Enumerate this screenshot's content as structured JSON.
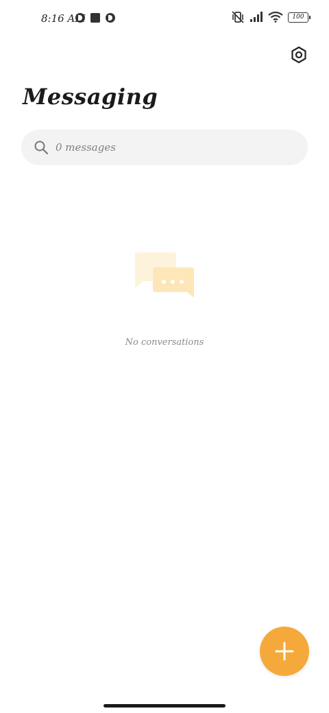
{
  "status_bar": {
    "time": "8:16 AM",
    "battery": "100"
  },
  "header": {
    "title": "Messaging"
  },
  "search": {
    "placeholder": "0 messages"
  },
  "empty_state": {
    "text": "No conversations"
  },
  "colors": {
    "accent": "#f6a93b",
    "search_bg": "#f3f3f3",
    "illustration_light": "#fdf3dc",
    "illustration_dark": "#fde7b8"
  },
  "icons": {
    "settings": "gear-icon",
    "search": "search-icon",
    "fab": "plus-icon"
  }
}
